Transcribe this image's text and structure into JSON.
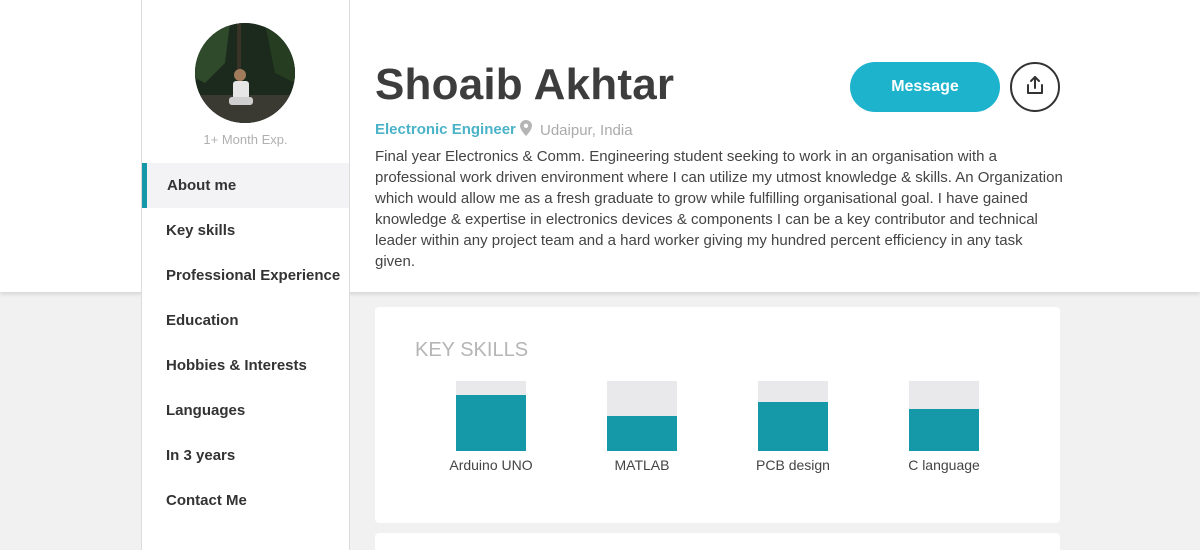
{
  "profile": {
    "name": "Shoaib Akhtar",
    "role": "Electronic Engineer",
    "location": "Udaipur, India",
    "experience": "1+ Month Exp.",
    "bio": "Final year Electronics & Comm. Engineering student seeking to work in an organisation with a professional work driven environment where I can utilize my utmost knowledge & skills. An Organization which would allow me as a fresh graduate to grow while fulfilling organisational goal. I have gained knowledge & expertise in electronics devices & components I can be a key contributor and technical leader within any project team and a hard worker giving my hundred percent efficiency in any task given."
  },
  "actions": {
    "message_label": "Message",
    "share_icon": "share-icon"
  },
  "nav": {
    "items": [
      {
        "label": "About me",
        "active": true
      },
      {
        "label": "Key skills"
      },
      {
        "label": "Professional Experience"
      },
      {
        "label": "Education"
      },
      {
        "label": "Hobbies & Interests"
      },
      {
        "label": "Languages"
      },
      {
        "label": "In 3 years"
      },
      {
        "label": "Contact Me"
      }
    ]
  },
  "skills": {
    "title": "KEY SKILLS",
    "items": [
      {
        "label": "Arduino UNO",
        "level": 0.8
      },
      {
        "label": "MATLAB",
        "level": 0.5
      },
      {
        "label": "PCB design",
        "level": 0.7
      },
      {
        "label": "C language",
        "level": 0.6
      }
    ]
  },
  "colors": {
    "accent": "#1598a8",
    "button": "#1db3cd",
    "role_text": "#4ab3c8"
  }
}
